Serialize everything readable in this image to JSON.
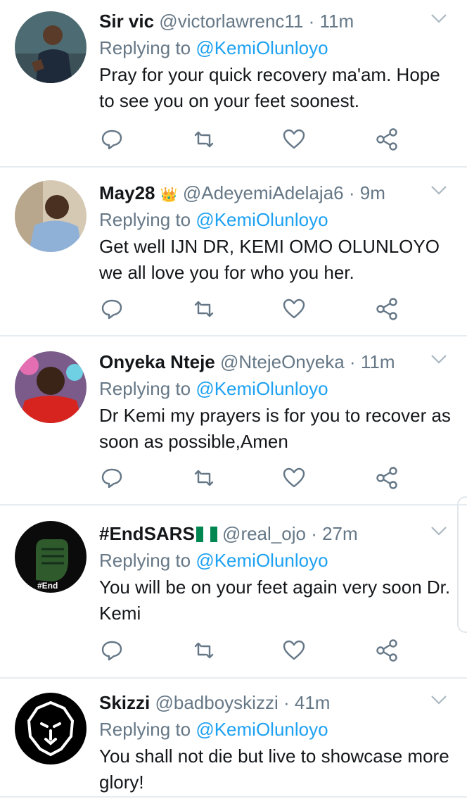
{
  "replying_label": "Replying to",
  "mention": "@KemiOlunloyo",
  "tweets": [
    {
      "name": "Sir vic",
      "handle": "@victorlawrenc11",
      "time": "11m",
      "text": "Pray for your quick recovery ma'am. Hope to see you on your feet soonest."
    },
    {
      "name": "May28",
      "badge": "👑",
      "handle": "@AdeyemiAdelaja6",
      "time": "9m",
      "text": "Get well IJN DR, KEMI OMO OLUNLOYO we all love you for who you her."
    },
    {
      "name": "Onyeka Nteje",
      "handle": "@NtejeOnyeka",
      "time": "11m",
      "text": "Dr Kemi my prayers is for you to recover as soon as possible,Amen"
    },
    {
      "name": "#EndSARS",
      "badge": "🇳🇬",
      "handle": "@real_ojo",
      "time": "27m",
      "text": "You will be on your feet again very soon Dr. Kemi",
      "avatar_text": "#End"
    },
    {
      "name": "Skizzi",
      "handle": "@badboyskizzi",
      "time": "41m",
      "text": "You shall not die but live to showcase more glory!"
    }
  ],
  "separator": "·",
  "icons": {
    "reply": "reply-icon",
    "retweet": "retweet-icon",
    "like": "heart-icon",
    "share": "share-icon",
    "menu": "chevron-down-icon"
  },
  "colors": {
    "mention": "#1da1f2",
    "muted": "#657786",
    "text": "#14171a",
    "divider": "#e6ecf0"
  }
}
